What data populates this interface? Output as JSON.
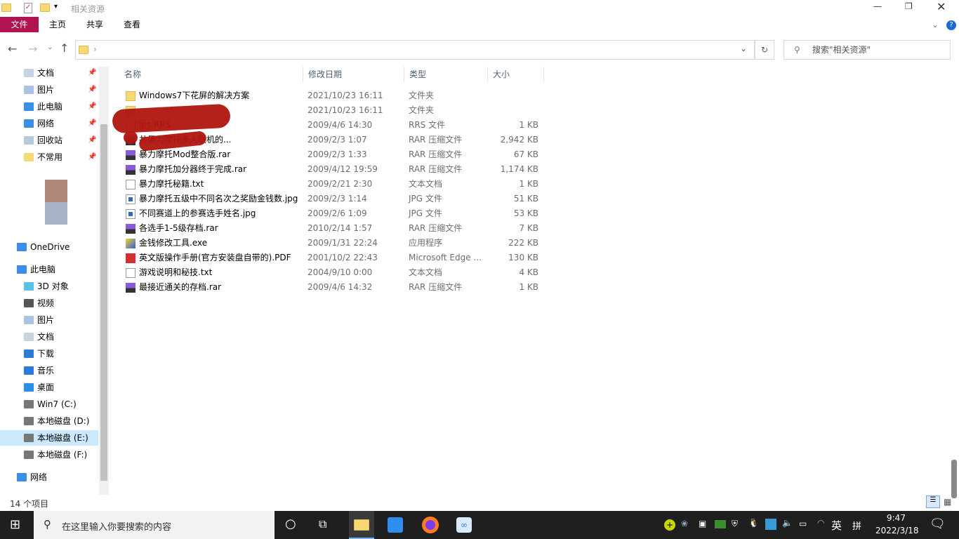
{
  "window": {
    "title": "相关资源",
    "item_count": "14 个项目"
  },
  "ribbon": {
    "tabs": [
      "文件",
      "主页",
      "共享",
      "查看"
    ],
    "accent": "#b0134f"
  },
  "search": {
    "placeholder": "搜索\"相关资源\""
  },
  "sidebar": {
    "quick": [
      {
        "label": "文档",
        "icon": "documents-icon"
      },
      {
        "label": "图片",
        "icon": "pictures-icon"
      },
      {
        "label": "此电脑",
        "icon": "computer-icon"
      },
      {
        "label": "网络",
        "icon": "network-icon"
      },
      {
        "label": "回收站",
        "icon": "recycle-bin-icon"
      },
      {
        "label": "不常用",
        "icon": "folder-icon"
      }
    ],
    "onedrive": "OneDrive",
    "thispc": "此电脑",
    "pc_items": [
      {
        "label": "3D 对象",
        "icon": "3d-objects-icon"
      },
      {
        "label": "视频",
        "icon": "videos-icon"
      },
      {
        "label": "图片",
        "icon": "pictures-icon"
      },
      {
        "label": "文档",
        "icon": "documents-icon"
      },
      {
        "label": "下载",
        "icon": "downloads-icon"
      },
      {
        "label": "音乐",
        "icon": "music-icon"
      },
      {
        "label": "桌面",
        "icon": "desktop-icon"
      },
      {
        "label": "Win7 (C:)",
        "icon": "drive-icon"
      },
      {
        "label": "本地磁盘 (D:)",
        "icon": "drive-icon"
      },
      {
        "label": "本地磁盘 (E:)",
        "icon": "drive-icon"
      },
      {
        "label": "本地磁盘 (F:)",
        "icon": "drive-icon"
      }
    ],
    "network": "网络"
  },
  "columns": {
    "name": "名称",
    "date": "修改日期",
    "type": "类型",
    "size": "大小"
  },
  "files": [
    {
      "name": "Windows7下花屏的解决方案",
      "date": "2021/10/23 16:11",
      "type": "文件夹",
      "size": "",
      "icon": "folder"
    },
    {
      "name": "",
      "date": "2021/10/23 16:11",
      "type": "文件夹",
      "size": "",
      "icon": "folder"
    },
    {
      "name": "lps.RRS",
      "date": "2009/4/6 14:30",
      "type": "RRS 文件",
      "size": "1 KB",
      "icon": "file"
    },
    {
      "name": "共暴力摩托多人联机的...",
      "date": "2009/2/3 1:07",
      "type": "RAR 压缩文件",
      "size": "2,942 KB",
      "icon": "rar"
    },
    {
      "name": "暴力摩托Mod整合版.rar",
      "date": "2009/2/3 1:33",
      "type": "RAR 压缩文件",
      "size": "67 KB",
      "icon": "rar"
    },
    {
      "name": "暴力摩托加分器终于完成.rar",
      "date": "2009/4/12 19:59",
      "type": "RAR 压缩文件",
      "size": "1,174 KB",
      "icon": "rar"
    },
    {
      "name": "暴力摩托秘籍.txt",
      "date": "2009/2/21 2:30",
      "type": "文本文档",
      "size": "1 KB",
      "icon": "txt"
    },
    {
      "name": "暴力摩托五级中不同名次之奖励金钱数.jpg",
      "date": "2009/2/3 1:14",
      "type": "JPG 文件",
      "size": "51 KB",
      "icon": "jpg"
    },
    {
      "name": "不同赛道上的参赛选手姓名.jpg",
      "date": "2009/2/6 1:09",
      "type": "JPG 文件",
      "size": "53 KB",
      "icon": "jpg"
    },
    {
      "name": "各选手1-5级存档.rar",
      "date": "2010/2/14 1:57",
      "type": "RAR 压缩文件",
      "size": "7 KB",
      "icon": "rar"
    },
    {
      "name": "金钱修改工具.exe",
      "date": "2009/1/31 22:24",
      "type": "应用程序",
      "size": "222 KB",
      "icon": "exe"
    },
    {
      "name": "英文版操作手册(官方安装盘自带的).PDF",
      "date": "2001/10/2 22:43",
      "type": "Microsoft Edge ...",
      "size": "130 KB",
      "icon": "pdf"
    },
    {
      "name": "游戏说明和秘技.txt",
      "date": "2004/9/10 0:00",
      "type": "文本文档",
      "size": "4 KB",
      "icon": "txt"
    },
    {
      "name": "最接近通关的存档.rar",
      "date": "2009/4/6 14:32",
      "type": "RAR 压缩文件",
      "size": "1 KB",
      "icon": "rar"
    }
  ],
  "taskbar": {
    "search_placeholder": "在这里输入你要搜索的内容",
    "time": "9:47",
    "date": "2022/3/18",
    "ime": "英",
    "ime2": "拼"
  }
}
